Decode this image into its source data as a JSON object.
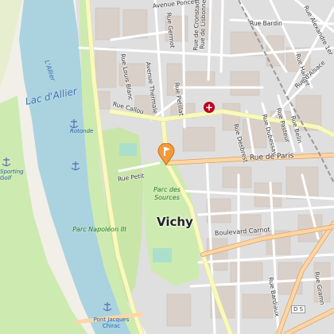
{
  "map": {
    "colors": {
      "background": "#f2efe9",
      "water": "#aad3df",
      "park": "#cdebb0",
      "pitch": "#aae0cb",
      "residential": "#e0dfdf",
      "building": "#d9d0c9",
      "road_major": "#f7fabf",
      "road_primary": "#fcd6a4",
      "road_minor": "#ffffff",
      "marker": "#f39a3a",
      "hospital": "#b8001e"
    },
    "labels": {
      "avenue_poncet": "Avenue Poncet",
      "rue_bardin": "Rue Bardin",
      "rue_alexandre_1er": "Rue Alexandre 1er",
      "rue_de_lisbonne": "Rue de Lisbonne",
      "rue_de_cronstadt": "Rue de Cronstadt",
      "rue_germot": "Rue Germot",
      "rue_louis_blanc": "Rue Louis Blanc",
      "avenue_thermale": "Avenue Thermale",
      "rue_petillat": "Rue Petillat",
      "rue_callou": "Rue Callou",
      "rue_harpet": "Rue Harpet",
      "rue_d_alsace": "Rue d'Alsace",
      "rue_desbrest": "Rue Desbrest",
      "rue_dubessay": "Rue Dubessay",
      "rue_pasteur": "Rue Pasteur",
      "rue_belin": "Rue Belin",
      "rue_de_paris": "Rue de Paris",
      "rue_petit": "Rue Petit",
      "boulevard_carnot": "Boulevard Carnot",
      "rue_bardiaux": "Rue Bardiaux",
      "rue_gramn": "Rue Gramn",
      "lac_d_allier": "Lac d'Allier",
      "l_allier": "L'Allier",
      "rotonde": "Rotonde",
      "sporting_golf": "Sporting Golf",
      "parc_des_sources": "Parc des Sources",
      "parc_napoleon_iii": "Parc Napoléon III",
      "vichy": "Vichy",
      "pont_jacques_chirac": "Pont Jacques Chirac",
      "road_ref": "D S"
    },
    "icons": {
      "location_marker": "location-pin-icon",
      "hospital": "hospital-cross-icon",
      "anchors": "anchor-icon"
    }
  }
}
